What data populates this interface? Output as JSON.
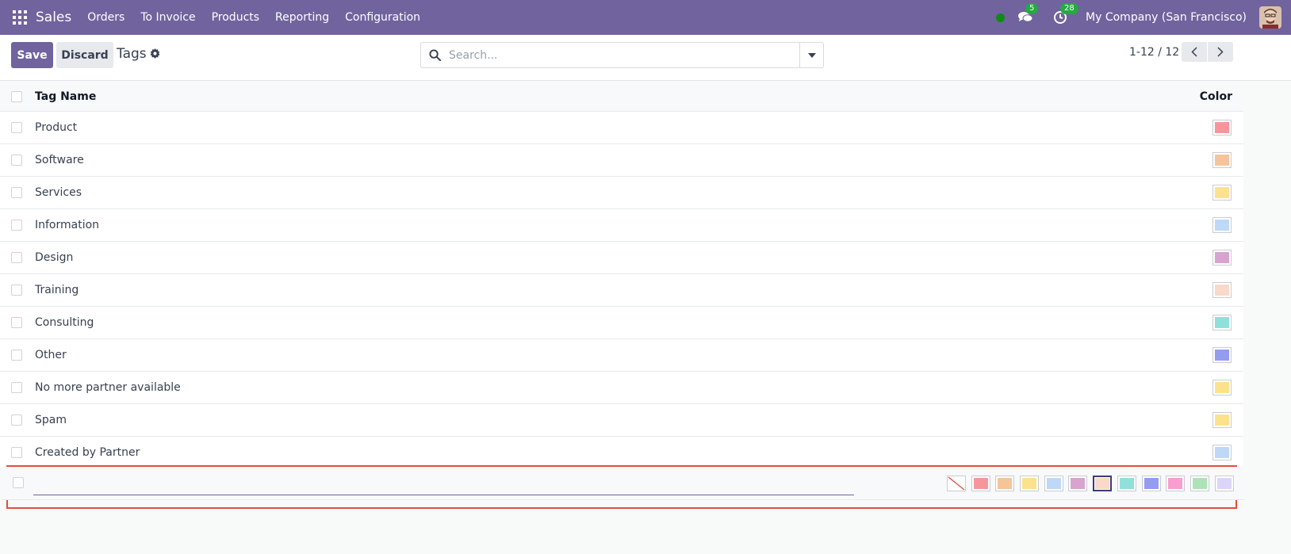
{
  "navbar": {
    "brand": "Sales",
    "menu": [
      "Orders",
      "To Invoice",
      "Products",
      "Reporting",
      "Configuration"
    ],
    "messages_count": "5",
    "activities_count": "28",
    "company": "My Company (San Francisco)",
    "bg_color": "#71639e"
  },
  "control_panel": {
    "save_label": "Save",
    "discard_label": "Discard",
    "title": "Tags",
    "search_placeholder": "Search...",
    "pager": "1-12 / 12"
  },
  "list": {
    "header": {
      "name": "Tag Name",
      "color": "Color"
    },
    "rows": [
      {
        "name": "Product",
        "color": "#f7969a"
      },
      {
        "name": "Software",
        "color": "#f6c499"
      },
      {
        "name": "Services",
        "color": "#fde28d"
      },
      {
        "name": "Information",
        "color": "#bfd8f8"
      },
      {
        "name": "Design",
        "color": "#d8a4cf"
      },
      {
        "name": "Training",
        "color": "#f9d9ca"
      },
      {
        "name": "Consulting",
        "color": "#8fe0da"
      },
      {
        "name": "Other",
        "color": "#949cf0"
      },
      {
        "name": "No more partner available",
        "color": "#fde28d"
      },
      {
        "name": "Spam",
        "color": "#fde28d"
      },
      {
        "name": "Created by Partner",
        "color": "#bfd8f8"
      }
    ]
  },
  "new_row": {
    "value": "",
    "palette": [
      {
        "name": "no-color",
        "color": "#ffffff"
      },
      {
        "name": "red",
        "color": "#f7969a"
      },
      {
        "name": "orange",
        "color": "#f6c499"
      },
      {
        "name": "yellow",
        "color": "#fde28d"
      },
      {
        "name": "light-blue",
        "color": "#bfd8f8"
      },
      {
        "name": "dark-purple",
        "color": "#d8a4cf"
      },
      {
        "name": "salmon-pink",
        "color": "#f9d9ca"
      },
      {
        "name": "medium-blue",
        "color": "#8fe0da"
      },
      {
        "name": "dark-blue",
        "color": "#949cf0"
      },
      {
        "name": "fuchsia",
        "color": "#f89ed0"
      },
      {
        "name": "green",
        "color": "#aee3b7"
      },
      {
        "name": "purple",
        "color": "#ddd5f8"
      }
    ],
    "selected_index": 6
  }
}
